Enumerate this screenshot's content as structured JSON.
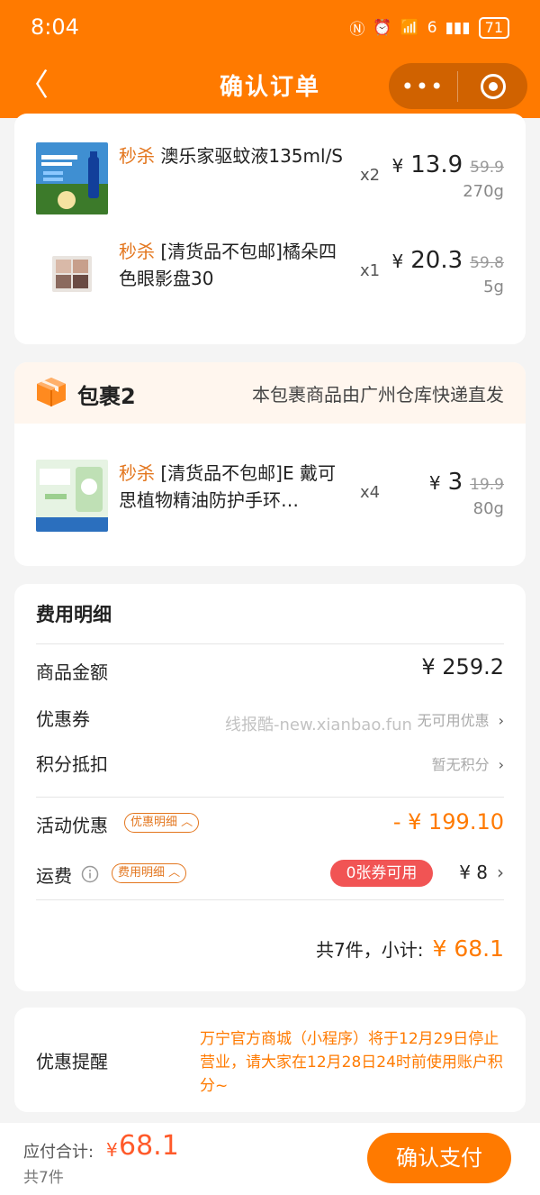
{
  "status_bar": {
    "time": "8:04",
    "signal": "6",
    "battery": "71"
  },
  "header": {
    "back_icon": "chevron-left-icon",
    "title": "确认订单",
    "more_icon": "ellipsis-icon",
    "target_icon": "target-icon"
  },
  "package1": {
    "items": [
      {
        "flash": "秒杀",
        "name": "澳乐家驱蚊液135ml/S",
        "qty": "x2",
        "currency": "¥",
        "price": "13.9",
        "old_price": "59.9",
        "weight": "270g"
      },
      {
        "flash": "秒杀",
        "name": "[清货品不包邮]橘朵四色眼影盘30",
        "qty": "x1",
        "currency": "¥",
        "price": "20.3",
        "old_price": "59.8",
        "weight": "5g"
      }
    ]
  },
  "package2": {
    "title": "包裹2",
    "note": "本包裹商品由广州仓库快递直发",
    "items": [
      {
        "flash": "秒杀",
        "name": "[清货品不包邮]E 戴可思植物精油防护手环…",
        "qty": "x4",
        "currency": "¥",
        "price": "3",
        "old_price": "19.9",
        "weight": "80g"
      }
    ]
  },
  "fees": {
    "title": "费用明细",
    "goods_label": "商品金额",
    "goods_value": "¥ 259.2",
    "coupon_label": "优惠券",
    "coupon_value": "无可用优惠",
    "points_label": "积分抵扣",
    "points_value": "暂无积分",
    "promo_label": "活动优惠",
    "promo_tag": "优惠明细",
    "promo_value": "- ¥ 199.10",
    "shipping_label": "运费",
    "shipping_tag": "费用明细",
    "shipping_coupon": "0张券可用",
    "shipping_value": "¥ 8",
    "subtotal_label": "共7件，小计:",
    "subtotal_value": "¥ 68.1",
    "chevron": "›"
  },
  "reminder": {
    "label": "优惠提醒",
    "text": "万宁官方商城（小程序）将于12月29日停止营业，请大家在12月28日24时前使用账户积分~"
  },
  "bottom": {
    "pay_label": "应付合计:",
    "currency": "¥",
    "pay_amount": "68.1",
    "count": "共7件",
    "confirm": "确认支付"
  },
  "watermark": "线报酷-new.xianbao.fun",
  "colors": {
    "brand": "#ff7a00",
    "flash": "#e3761e",
    "coupon_pill": "#f15454"
  }
}
